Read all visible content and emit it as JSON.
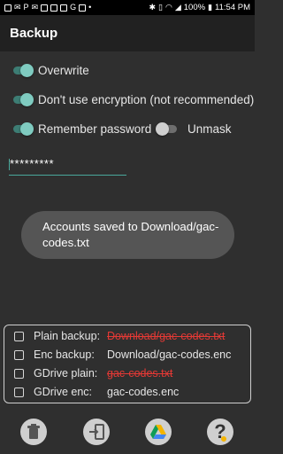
{
  "status_bar": {
    "left_icons": [
      "notification-icon",
      "notification-icon",
      "paypal-icon",
      "mail-icon",
      "linkedin-icon",
      "notification-icon",
      "image-icon",
      "google-icon",
      "notification-icon",
      "more-icon"
    ],
    "battery_text": "100%",
    "time": "11:54 PM"
  },
  "app_bar": {
    "title": "Backup"
  },
  "options": {
    "overwrite": {
      "label": "Overwrite",
      "on": true
    },
    "no_encryption": {
      "label": "Don't use encryption (not recommended)",
      "on": true
    },
    "remember_password": {
      "label": "Remember password",
      "on": true
    },
    "unmask": {
      "label": "Unmask",
      "on": false
    }
  },
  "password": {
    "value": "*********"
  },
  "toast": {
    "text": "Accounts saved to Download/gac-codes.txt"
  },
  "files": [
    {
      "label": "Plain backup:",
      "name": "Download/gac-codes.txt",
      "style": "red-strike"
    },
    {
      "label": "Enc backup:",
      "name": "Download/gac-codes.enc",
      "style": "normal"
    },
    {
      "label": "GDrive plain:",
      "name": "gac-codes.txt",
      "style": "red-strike"
    },
    {
      "label": "GDrive enc:",
      "name": "gac-codes.enc",
      "style": "normal"
    }
  ],
  "bottom_buttons": [
    {
      "icon": "trash-icon"
    },
    {
      "icon": "import-icon"
    },
    {
      "icon": "google-drive-icon"
    },
    {
      "icon": "help-icon"
    }
  ],
  "colors": {
    "accent": "#4aa89b",
    "error": "#e53935",
    "background": "#2f2f2f"
  }
}
